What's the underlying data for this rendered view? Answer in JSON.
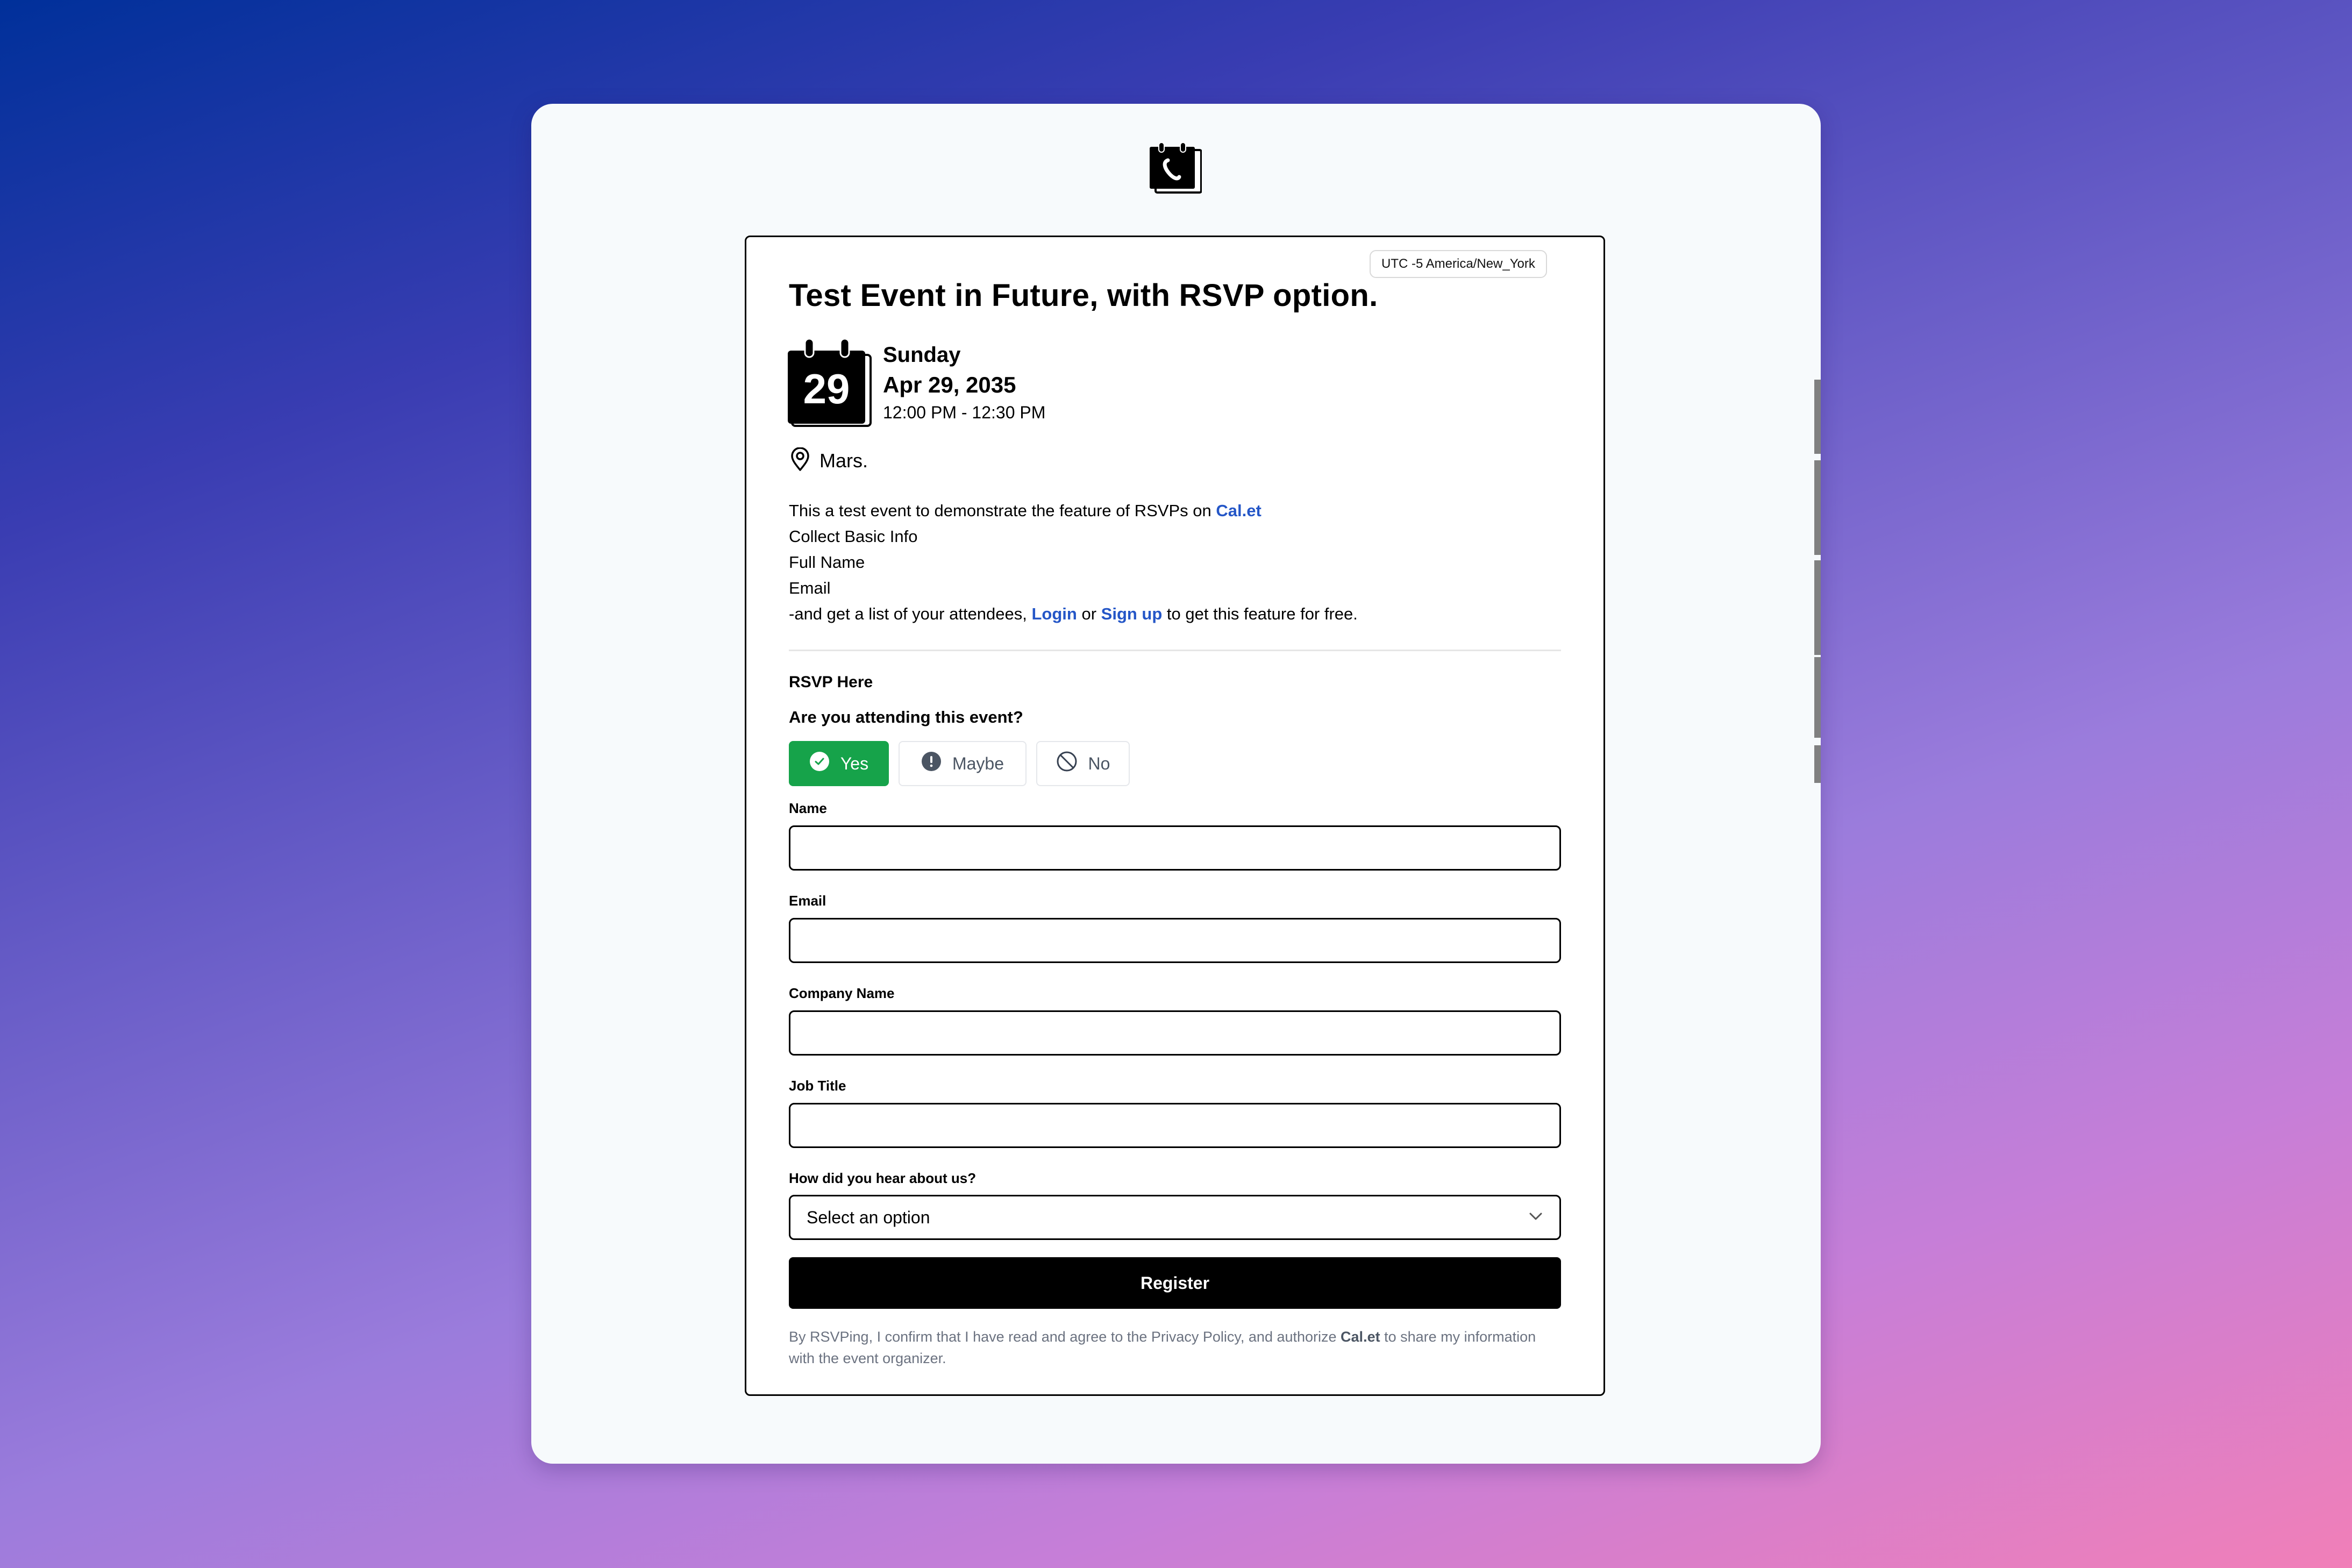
{
  "app": {
    "logo_icon": "calendar-phone-logo-icon"
  },
  "event": {
    "timezone": "UTC -5 America/New_York",
    "title": "Test Event in Future, with RSVP option.",
    "calendar_day": "29",
    "weekday": "Sunday",
    "date": "Apr 29, 2035",
    "time_range": "12:00 PM - 12:30 PM",
    "location_icon": "map-pin-icon",
    "location": "Mars.",
    "description": {
      "line1_text": "This a test event to demonstrate the feature of RSVPs on ",
      "line1_link": "Cal.et",
      "line2": "Collect Basic Info",
      "line3": "Full Name",
      "line4": "Email",
      "line5_prefix": "-and get a list of your attendees, ",
      "line5_login": "Login",
      "line5_or": " or ",
      "line5_signup": "Sign up",
      "line5_suffix": " to get this feature for free."
    }
  },
  "rsvp": {
    "heading": "RSVP Here",
    "question": "Are you attending this event?",
    "selected": "Yes",
    "options": [
      {
        "label": "Yes",
        "icon": "check-circle-icon"
      },
      {
        "label": "Maybe",
        "icon": "exclamation-circle-icon"
      },
      {
        "label": "No",
        "icon": "ban-icon"
      }
    ],
    "colors": {
      "selected_bg": "#16a34a",
      "link": "#2456c7"
    }
  },
  "form": {
    "fields": [
      {
        "label": "Name",
        "value": ""
      },
      {
        "label": "Email",
        "value": ""
      },
      {
        "label": "Company Name",
        "value": ""
      },
      {
        "label": "Job Title",
        "value": ""
      }
    ],
    "source_label": "How did you hear about us?",
    "source_value": "Select an option",
    "register_label": "Register",
    "consent_prefix": "By RSVPing, I confirm that I have read and agree to the Privacy Policy, and authorize ",
    "consent_brand": "Cal.et",
    "consent_suffix": " to share my information with the event organizer."
  }
}
